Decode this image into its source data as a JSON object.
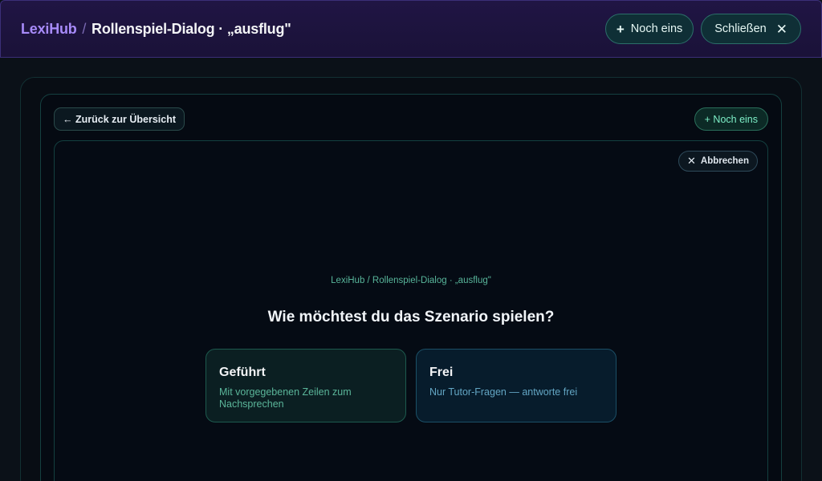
{
  "header": {
    "brand": "LexiHub",
    "separator": "/",
    "title": "Rollenspiel-Dialog · „ausflug\"",
    "buttons": {
      "more_icon": "+",
      "more_label": "Noch eins",
      "close_label": "Schließen",
      "close_icon": "✕"
    }
  },
  "toolbar": {
    "back_label": "← Zurück zur Übersicht",
    "more_label": "+ Noch eins"
  },
  "card": {
    "cancel_icon": "✕",
    "cancel_label": "Abbrechen",
    "breadcrumb": "LexiHub / Rollenspiel-Dialog · „ausflug\"",
    "question": "Wie möchtest du das Szenario spielen?",
    "options": [
      {
        "title": "Geführt",
        "description": "Mit vorgegebenen Zeilen zum Nachsprechen"
      },
      {
        "title": "Frei",
        "description": "Nur Tutor-Fragen — antworte frei"
      }
    ]
  },
  "colors": {
    "accent_brand": "#a78bfa",
    "accent_teal": "#7ef0c8",
    "background": "#0b1118"
  }
}
